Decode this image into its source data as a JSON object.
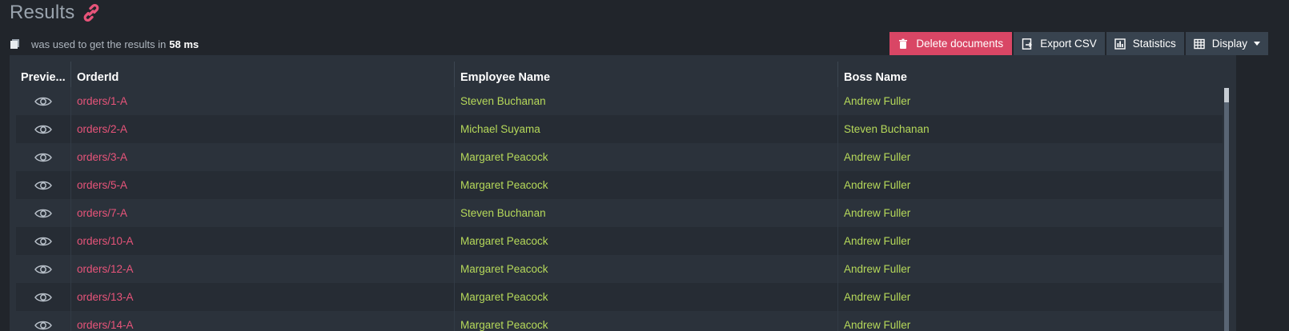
{
  "page": {
    "title": "Results"
  },
  "info": {
    "prefix": "was used to get the results in",
    "duration": "58 ms"
  },
  "toolbar": {
    "delete_label": "Delete documents",
    "export_label": "Export CSV",
    "statistics_label": "Statistics",
    "display_label": "Display"
  },
  "columns": {
    "preview": "Previe...",
    "order": "OrderId",
    "employee": "Employee Name",
    "boss": "Boss Name"
  },
  "rows": [
    {
      "order": "orders/1-A",
      "employee": "Steven Buchanan",
      "boss": "Andrew Fuller"
    },
    {
      "order": "orders/2-A",
      "employee": "Michael Suyama",
      "boss": "Steven Buchanan"
    },
    {
      "order": "orders/3-A",
      "employee": "Margaret Peacock",
      "boss": "Andrew Fuller"
    },
    {
      "order": "orders/5-A",
      "employee": "Margaret Peacock",
      "boss": "Andrew Fuller"
    },
    {
      "order": "orders/7-A",
      "employee": "Steven Buchanan",
      "boss": "Andrew Fuller"
    },
    {
      "order": "orders/10-A",
      "employee": "Margaret Peacock",
      "boss": "Andrew Fuller"
    },
    {
      "order": "orders/12-A",
      "employee": "Margaret Peacock",
      "boss": "Andrew Fuller"
    },
    {
      "order": "orders/13-A",
      "employee": "Margaret Peacock",
      "boss": "Andrew Fuller"
    },
    {
      "order": "orders/14-A",
      "employee": "Margaret Peacock",
      "boss": "Andrew Fuller"
    }
  ],
  "colors": {
    "accent_pink": "#e8547a",
    "accent_green": "#b6d95a",
    "danger": "#d94665",
    "background": "#21252b"
  },
  "icons": {
    "title": "link-icon",
    "info": "document-icon",
    "preview": "eye-icon"
  }
}
